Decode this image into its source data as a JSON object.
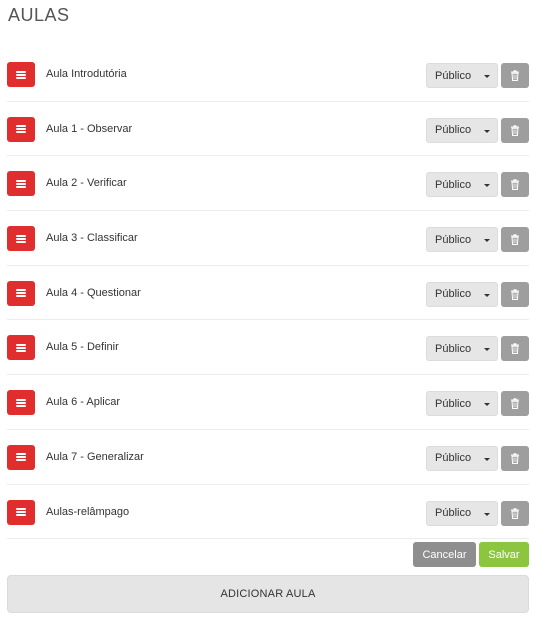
{
  "page": {
    "title": "AULAS"
  },
  "lessons": [
    {
      "title": "Aula Introdutória",
      "visibility": "Público"
    },
    {
      "title": "Aula 1 - Observar",
      "visibility": "Público"
    },
    {
      "title": "Aula 2 - Verificar",
      "visibility": "Público"
    },
    {
      "title": "Aula 3 - Classificar",
      "visibility": "Público"
    },
    {
      "title": "Aula 4 - Questionar",
      "visibility": "Público"
    },
    {
      "title": "Aula 5 - Definir",
      "visibility": "Público"
    },
    {
      "title": "Aula 6 - Aplicar",
      "visibility": "Público"
    },
    {
      "title": "Aula 7 - Generalizar",
      "visibility": "Público"
    },
    {
      "title": "Aulas-relâmpago",
      "visibility": "Público"
    }
  ],
  "actions": {
    "cancel_label": "Cancelar",
    "save_label": "Salvar"
  },
  "add_lesson": {
    "label": "ADICIONAR AULA"
  },
  "icons": {
    "drag": "menu-icon",
    "dropdown": "caret-down-icon",
    "delete": "trash-icon"
  },
  "colors": {
    "drag_handle": "#e02d2d",
    "save": "#8cc63f",
    "cancel": "#8e8e8e",
    "delete": "#9e9e9e"
  }
}
